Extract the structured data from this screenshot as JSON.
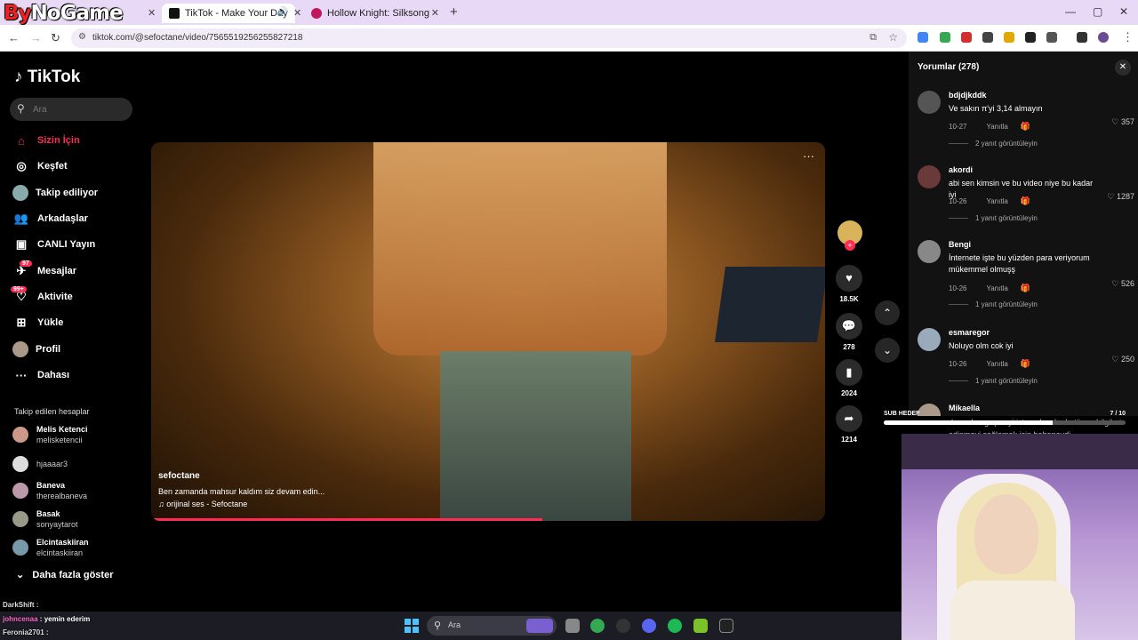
{
  "browser": {
    "brand_prefix": "By",
    "brand_suffix": "NoGame",
    "tabs": [
      {
        "label": "TikTok - Make Your Day",
        "active": true
      },
      {
        "label": "Hollow Knight: Silksong",
        "active": false
      }
    ],
    "new_tab": "+",
    "url": "tiktok.com/@sefoctane/video/7565519256255827218"
  },
  "tiktok": {
    "logo": "TikTok",
    "search_placeholder": "Ara",
    "nav": [
      {
        "label": "Sizin İçin",
        "icon": "home-icon",
        "selected": true
      },
      {
        "label": "Keşfet",
        "icon": "compass-icon"
      },
      {
        "label": "Takip ediliyor",
        "icon": "following-avatar-icon"
      },
      {
        "label": "Arkadaşlar",
        "icon": "friends-icon"
      },
      {
        "label": "CANLI Yayın",
        "icon": "live-icon"
      },
      {
        "label": "Mesajlar",
        "icon": "messages-icon",
        "badge": "97"
      },
      {
        "label": "Aktivite",
        "icon": "activity-icon",
        "badge": "99+"
      },
      {
        "label": "Yükle",
        "icon": "upload-icon"
      },
      {
        "label": "Profil",
        "icon": "profile-avatar-icon"
      },
      {
        "label": "Dahası",
        "icon": "more-dots-icon"
      }
    ],
    "followed_header": "Takip edilen hesaplar",
    "followed": [
      {
        "name": "Melis Ketenci",
        "user": "melisketencii"
      },
      {
        "name": "",
        "user": "hjaaaar3"
      },
      {
        "name": "Baneva",
        "user": "therealbaneva"
      },
      {
        "name": "Basak",
        "user": "sonyaytarot"
      },
      {
        "name": "Elcintaskiiran",
        "user": "elcintaskiiran"
      }
    ],
    "show_more": "Daha fazla göster"
  },
  "video": {
    "author": "sefoctane",
    "caption": "Ben zamanda mahsur kaldım siz devam edin...",
    "sound": "♫ orijinal ses - Sefoctane",
    "progress": 0.58,
    "likes": "18.5K",
    "comments": "278",
    "saves": "2024",
    "shares": "1214"
  },
  "comments": {
    "title": "Yorumlar (278)",
    "reply_label": "Yanıtla",
    "items": [
      {
        "user": "bdjdjkddk",
        "text": "Ve sakın π'yi 3,14 almayın",
        "date": "10-27",
        "likes": "357",
        "replies": "2 yanıt görüntüleyin"
      },
      {
        "user": "akordi",
        "text": "abi sen kimsin ve bu video niye bu kadar iyi",
        "date": "10-26",
        "likes": "1287",
        "replies": "1 yanıt görüntüleyin"
      },
      {
        "user": "Bengi",
        "text": "İnternete işte bu yüzden para veriyorum mükemmel olmuşş",
        "date": "10-26",
        "likes": "526",
        "replies": "1 yanıt görüntüleyin"
      },
      {
        "user": "esmaregor",
        "text": "Noluyo olm cok iyi",
        "date": "10-26",
        "likes": "250",
        "replies": "1 yanıt görüntüleyin"
      },
      {
        "user": "Mikaella",
        "text": "duvardan geçmeyi istemek aslında tüm o bilgileri edinmeyi sağlamak için bahaneydi",
        "date": "",
        "likes": "",
        "replies": ""
      }
    ]
  },
  "overlay": {
    "sub_goal_label": "SUB HEDEF",
    "sub_goal_progress": "7 / 10",
    "sub_goal_fraction": 0.7,
    "chat": [
      {
        "user": "DarkShift",
        "msg": ""
      },
      {
        "user": "johncenaa",
        "msg": "yemin ederim"
      },
      {
        "user": "Feronia2701",
        "msg": ""
      }
    ]
  },
  "taskbar": {
    "search_label": "Ara"
  },
  "colors": {
    "accent": "#fe2c55",
    "tabstrip": "#e8d9f7",
    "comments_bg": "#121212"
  }
}
